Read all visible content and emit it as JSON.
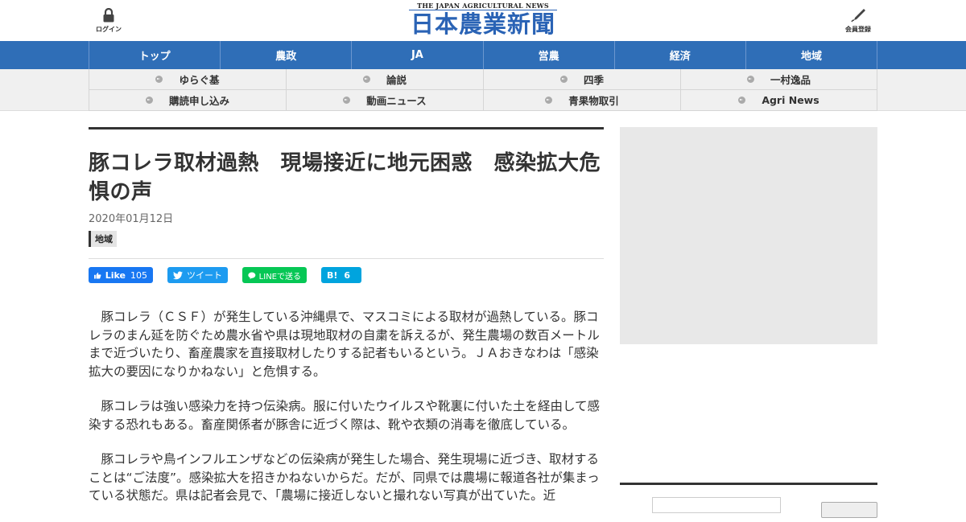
{
  "header": {
    "login_label": "ログイン",
    "member_label": "会員登録",
    "logo_en": "THE JAPAN AGRICULTURAL NEWS",
    "logo_ja": "日本農業新聞"
  },
  "nav_primary": [
    {
      "label": "トップ"
    },
    {
      "label": "農政"
    },
    {
      "label": "JA"
    },
    {
      "label": "営農"
    },
    {
      "label": "経済"
    },
    {
      "label": "地域"
    }
  ],
  "nav_secondary": [
    {
      "label": "ゆらぐ基"
    },
    {
      "label": "論説"
    },
    {
      "label": "四季"
    },
    {
      "label": "一村逸品"
    },
    {
      "label": "購読申し込み"
    },
    {
      "label": "動画ニュース"
    },
    {
      "label": "青果物取引"
    },
    {
      "label": "Agri News"
    }
  ],
  "article": {
    "title": "豚コレラ取材過熱　現場接近に地元困惑　感染拡大危惧の声",
    "date": "2020年01月12日",
    "tag": "地域",
    "share": {
      "facebook_label": "Like",
      "facebook_count": "105",
      "twitter_label": "ツイート",
      "line_label": "LINEで送る",
      "hatena_label": "B!",
      "hatena_count": "6"
    },
    "paragraphs": [
      "豚コレラ（ＣＳＦ）が発生している沖縄県で、マスコミによる取材が過熱している。豚コレラのまん延を防ぐため農水省や県は現地取材の自粛を訴えるが、発生農場の数百メートルまで近づいたり、畜産農家を直接取材したりする記者もいるという。ＪＡおきなわは「感染拡大の要因になりかねない」と危惧する。",
      "豚コレラは強い感染力を持つ伝染病。服に付いたウイルスや靴裏に付いた土を経由して感染する恐れもある。畜産関係者が豚舎に近づく際は、靴や衣類の消毒を徹底している。",
      "豚コレラや鳥インフルエンザなどの伝染病が発生した場合、発生現場に近づき、取材することは“ご法度”。感染拡大を招きかねないからだ。だが、同県では農場に報道各社が集まっている状態だ。県は記者会見で、「農場に接近しないと撮れない写真が出ていた。近"
    ]
  },
  "colors": {
    "nav_primary_bg": "#2f6eb7",
    "logo_blue": "#2a63b5",
    "facebook": "#1877f2",
    "twitter": "#1d9bf0",
    "line": "#06c755",
    "hatena": "#00a4de"
  },
  "icons": {
    "login": "lock-icon",
    "member": "pen-icon",
    "twitter": "bird-icon",
    "facebook": "thumbs-up-icon",
    "line": "line-icon"
  }
}
